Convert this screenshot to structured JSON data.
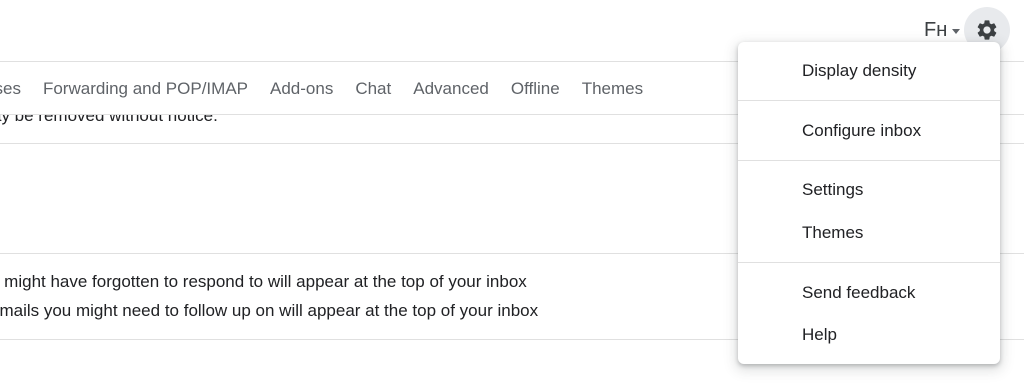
{
  "topbar": {
    "input_tools_label": "Fʜ",
    "gear_icon": "gear-icon"
  },
  "tabs": [
    {
      "label": "sses"
    },
    {
      "label": "Forwarding and POP/IMAP"
    },
    {
      "label": "Add-ons"
    },
    {
      "label": "Chat"
    },
    {
      "label": "Advanced"
    },
    {
      "label": "Offline"
    },
    {
      "label": "Themes"
    }
  ],
  "content": {
    "cut_notice": "ay be removed without notice.",
    "nudge_reply": "u might have forgotten to respond to will appear at the top of your inbox",
    "nudge_followup": "emails you might need to follow up on will appear at the top of your inbox"
  },
  "menu": {
    "items": [
      {
        "label": "Display density"
      },
      {
        "label": "Configure inbox"
      },
      {
        "label": "Settings"
      },
      {
        "label": "Themes"
      },
      {
        "label": "Send feedback"
      },
      {
        "label": "Help"
      }
    ]
  },
  "colors": {
    "text": "#202124",
    "muted": "#5f6368",
    "divider": "#e0e0e0",
    "gear_bg": "#e8eaed"
  }
}
